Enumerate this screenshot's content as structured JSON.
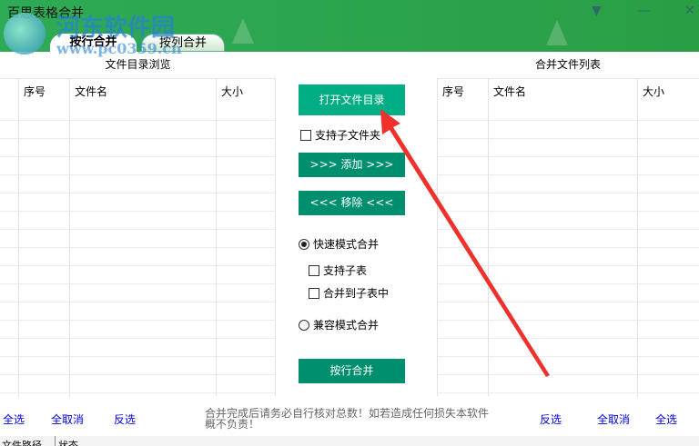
{
  "window": {
    "title": "百思表格合并",
    "controls": {
      "dropdown": "▼",
      "minimize": "—",
      "close": "✕"
    }
  },
  "tabs": [
    {
      "label": "按行合并",
      "active": true
    },
    {
      "label": "按列合并",
      "active": false
    }
  ],
  "left_panel": {
    "title": "文件目录浏览",
    "columns": [
      "序号",
      "文件名",
      "大小"
    ],
    "select_all": "全选",
    "deselect_all": "全取消",
    "invert": "反选"
  },
  "right_panel": {
    "title": "合并文件列表",
    "columns": [
      "序号",
      "文件名",
      "大小"
    ],
    "select_all": "全选",
    "deselect_all": "全取消",
    "invert": "反选"
  },
  "middle": {
    "open_dir": "打开文件目录",
    "include_subfolders": {
      "label": "支持子文件夹",
      "checked": false
    },
    "add": ">>>  添加  >>>",
    "remove": "<<<  移除  <<<",
    "fast_mode": {
      "label": "快速模式合并",
      "selected": true
    },
    "support_subsheet": {
      "label": "支持子表",
      "checked": false
    },
    "merge_to_subsheet": {
      "label": "合并到子表中",
      "checked": false
    },
    "compat_mode": {
      "label": "兼容模式合并",
      "selected": false
    },
    "merge_rows": "按行合并"
  },
  "notice": "合并完成后请务必自行核对总数！如若造成任何损失本软件概不负责！",
  "status": {
    "path_label": "文件路径",
    "state_label": "状态"
  },
  "watermark": {
    "name": "河东软件园",
    "url": "www.pc0359.cn"
  },
  "colors": {
    "titlebar": "#2eab55",
    "primary_button": "#00ad84",
    "button": "#008f6e",
    "link": "#0000ee",
    "arrow": "#f0302a"
  }
}
